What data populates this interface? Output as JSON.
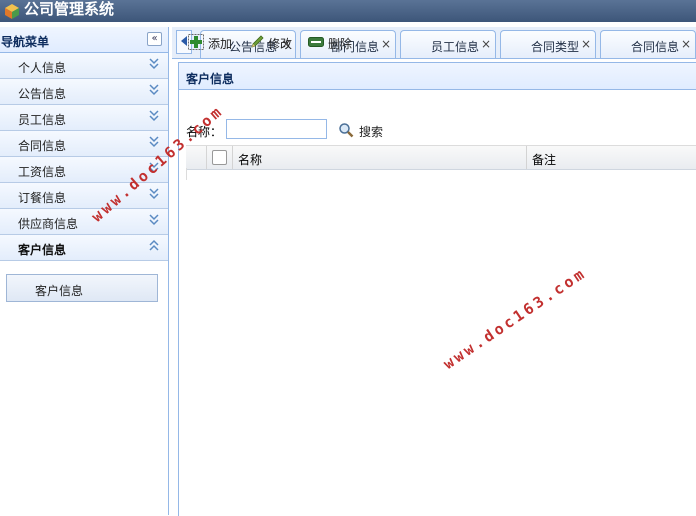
{
  "app": {
    "title": "公司管理系统"
  },
  "sidebar": {
    "title": "导航菜单",
    "collapse_glyph": "«",
    "items": [
      {
        "label": "个人信息",
        "expanded": false
      },
      {
        "label": "公告信息",
        "expanded": false
      },
      {
        "label": "员工信息",
        "expanded": false
      },
      {
        "label": "合同信息",
        "expanded": false
      },
      {
        "label": "工资信息",
        "expanded": false
      },
      {
        "label": "订餐信息",
        "expanded": false
      },
      {
        "label": "供应商信息",
        "expanded": false
      },
      {
        "label": "客户信息",
        "expanded": true
      }
    ],
    "submenu": {
      "label": "客户信息"
    }
  },
  "tabs": [
    {
      "label": "公告信息",
      "close": "×"
    },
    {
      "label": "部门信息",
      "close": "×"
    },
    {
      "label": "员工信息",
      "close": "×"
    },
    {
      "label": "合同类型",
      "close": "×"
    },
    {
      "label": "合同信息",
      "close": "×"
    }
  ],
  "panel": {
    "title": "客户信息",
    "toolbar": {
      "add": "添加",
      "edit": "修改",
      "delete": "删除"
    },
    "search": {
      "label": "名称：",
      "value": "",
      "button": "搜索"
    },
    "grid": {
      "columns": [
        "名称",
        "备注"
      ],
      "rows": []
    }
  },
  "watermarks": [
    "www.doc163.com",
    "www.doc163.com"
  ],
  "colors": {
    "header": "#3d5679",
    "border": "#95b8e7",
    "panel_head": "#e0ecff",
    "watermark": "#c2302f"
  }
}
